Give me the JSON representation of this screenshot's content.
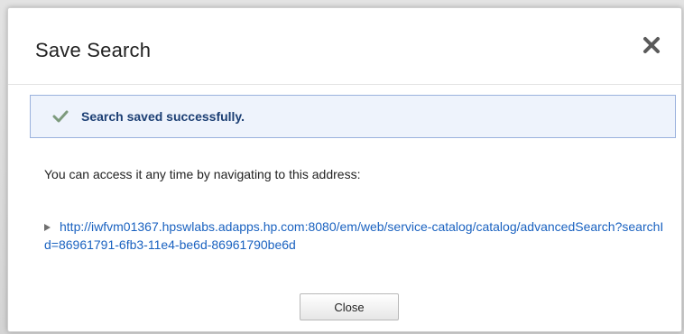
{
  "dialog": {
    "title": "Save Search",
    "close_icon": "close-x-icon",
    "success_message": "Search saved successfully.",
    "success_icon": "checkmark-icon",
    "info_text": "You can access it any time by navigating to this address:",
    "link_icon": "right-triangle-arrow-icon",
    "link_url": "http://iwfvm01367.hpswlabs.adapps.hp.com:8080/em/web/service-catalog/catalog/advancedSearch?searchId=86961791-6fb3-11e4-be6d-86961790be6d",
    "close_button_label": "Close"
  },
  "colors": {
    "banner_background": "#eef3fc",
    "banner_border": "#9bb2dd",
    "banner_text": "#1c3f74",
    "check_icon": "#7d9a7d",
    "link": "#1a62c0"
  }
}
